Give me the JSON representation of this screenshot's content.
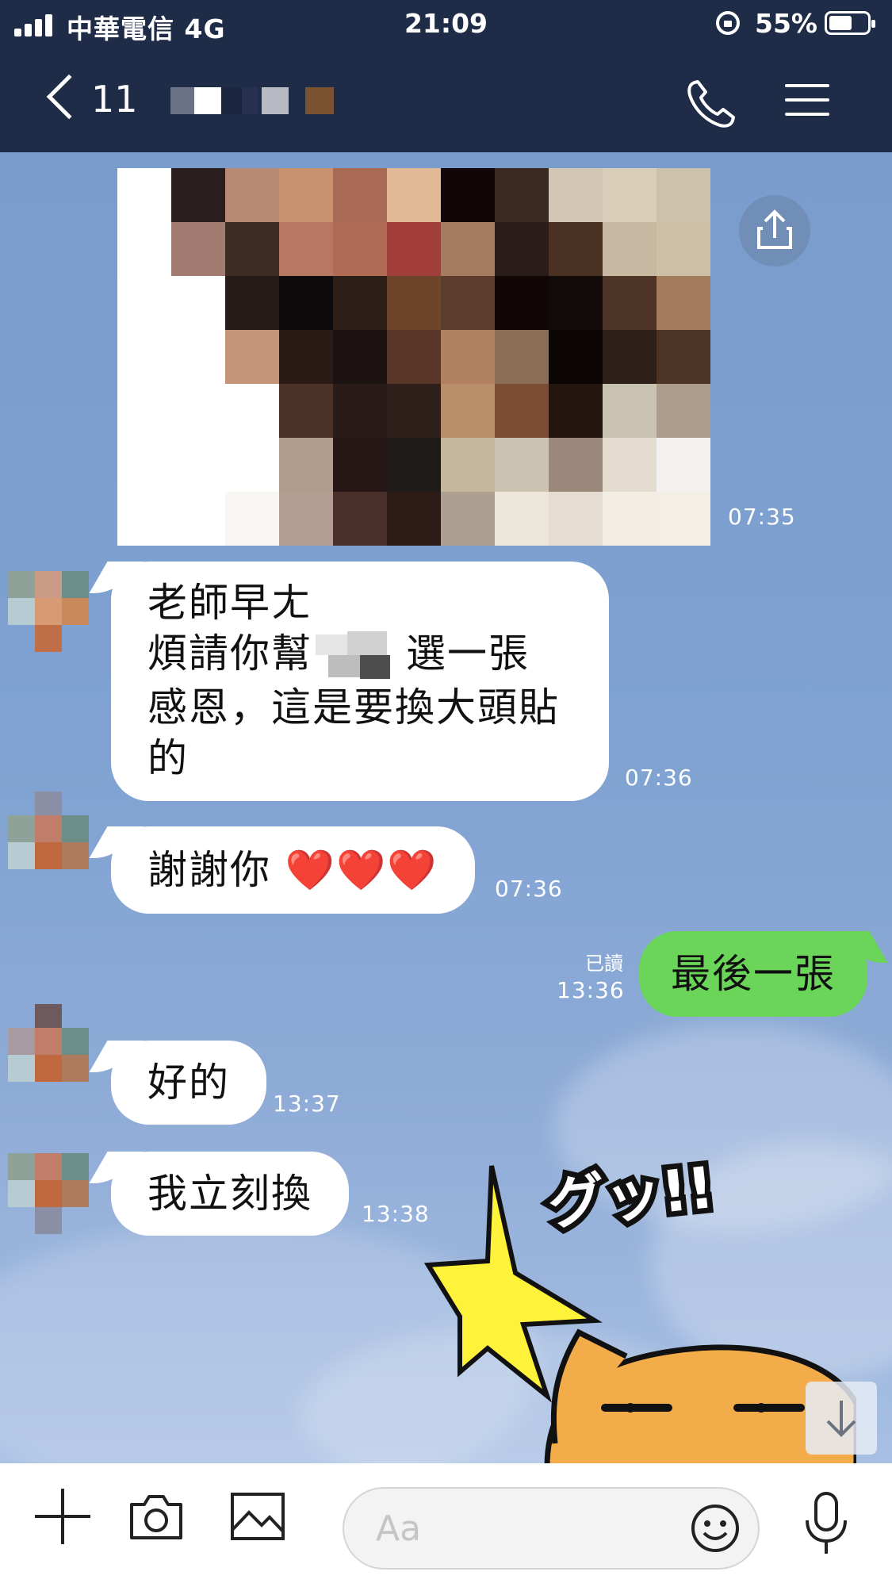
{
  "status_bar": {
    "carrier": "中華電信 4G",
    "time": "21:09",
    "battery_percent": "55%",
    "battery_level": 0.55,
    "signal_bars": 4
  },
  "header": {
    "unread_count": "11",
    "contact_name_redacted": true,
    "icons": [
      "back-chevron-icon",
      "phone-icon",
      "menu-icon"
    ]
  },
  "messages": [
    {
      "id": "m0",
      "type": "image",
      "side": "in",
      "time": "07:35"
    },
    {
      "id": "m1",
      "type": "text",
      "side": "in",
      "lines": [
        "老師早ㄤ",
        "煩請你幫",
        "選一張",
        "感恩，這是要換大頭貼",
        "的"
      ],
      "time": "07:36"
    },
    {
      "id": "m2",
      "type": "text",
      "side": "in",
      "text": "謝謝你",
      "emoji": "❤️❤️❤️",
      "time": "07:36"
    },
    {
      "id": "m3",
      "type": "text",
      "side": "out",
      "text": "最後一張",
      "read_label": "已讀",
      "time": "13:36"
    },
    {
      "id": "m4",
      "type": "text",
      "side": "in",
      "text": "好的",
      "time": "13:37"
    },
    {
      "id": "m5",
      "type": "text",
      "side": "in",
      "text": "我立刻換",
      "time": "13:38"
    }
  ],
  "sticker": {
    "text": "グッ!!"
  },
  "input_bar": {
    "placeholder": "Aa",
    "icons": [
      "plus-icon",
      "camera-icon",
      "image-icon",
      "emoji-icon",
      "microphone-icon"
    ]
  },
  "colors": {
    "header_bg": "#1f2c47",
    "chat_bg": "#7aa0cf",
    "outgoing_bubble": "#6bd55a",
    "incoming_bubble": "#ffffff",
    "heart": "#e8151b"
  }
}
